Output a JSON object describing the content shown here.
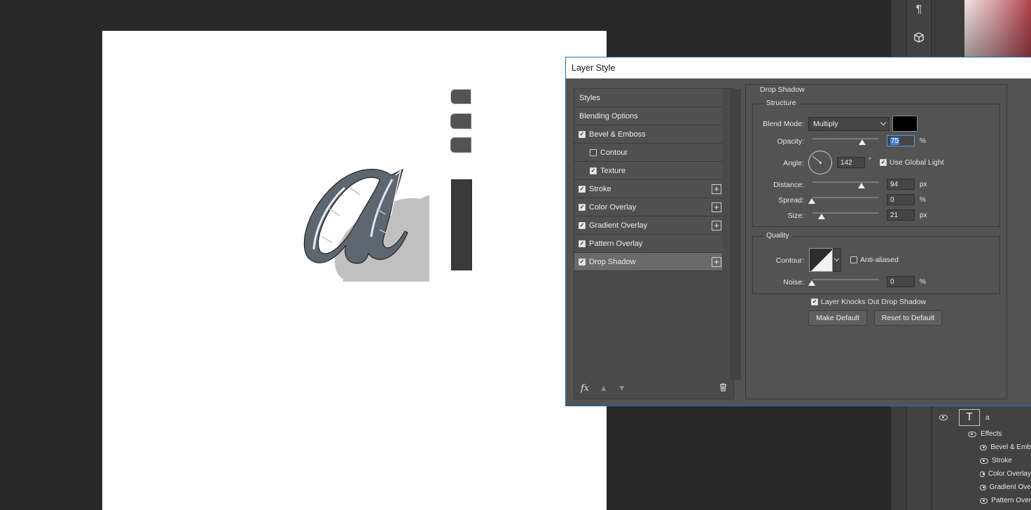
{
  "dialog": {
    "title": "Layer Style",
    "styles_list": [
      {
        "label": "Styles",
        "type": "header"
      },
      {
        "label": "Blending Options",
        "type": "header"
      },
      {
        "label": "Bevel & Emboss",
        "checked": true
      },
      {
        "label": "Contour",
        "checked": false,
        "sub": true
      },
      {
        "label": "Texture",
        "checked": true,
        "sub": true
      },
      {
        "label": "Stroke",
        "checked": true,
        "plus": true
      },
      {
        "label": "Color Overlay",
        "checked": true,
        "plus": true
      },
      {
        "label": "Gradient Overlay",
        "checked": true,
        "plus": true
      },
      {
        "label": "Pattern Overlay",
        "checked": true
      },
      {
        "label": "Drop Shadow",
        "checked": true,
        "plus": true,
        "selected": true
      }
    ],
    "footer": {
      "fx": "fx",
      "up_icon": "arrow-up-icon",
      "down_icon": "arrow-down-icon",
      "trash_icon": "trash-icon"
    },
    "drop_shadow": {
      "title": "Drop Shadow",
      "structure": {
        "title": "Structure",
        "blend_mode_label": "Blend Mode:",
        "blend_mode": "Multiply",
        "shadow_color": "#000000",
        "opacity_label": "Opacity:",
        "opacity": "75",
        "opacity_unit": "%",
        "opacity_fraction": 0.75,
        "angle_label": "Angle:",
        "angle": "142",
        "angle_unit": "°",
        "use_global_light_label": "Use Global Light",
        "use_global_light": true,
        "distance_label": "Distance:",
        "distance": "94",
        "distance_unit": "px",
        "distance_fraction": 0.75,
        "spread_label": "Spread:",
        "spread": "0",
        "spread_unit": "%",
        "size_label": "Size:",
        "size": "21",
        "size_unit": "px"
      },
      "quality": {
        "title": "Quality",
        "contour_label": "Contour:",
        "anti_aliased_label": "Anti-aliased",
        "anti_aliased": false,
        "noise_label": "Noise:",
        "noise": "0",
        "noise_unit": "%"
      },
      "layer_knocks_out_label": "Layer Knocks Out Drop Shadow",
      "layer_knocks_out": true,
      "make_default_label": "Make Default",
      "reset_default_label": "Reset to Default"
    }
  },
  "layers": {
    "text_layer_name": "a",
    "effects_label": "Effects",
    "effects": [
      "Bevel & Emb",
      "Stroke",
      "Color Overlay",
      "Gradient Ove",
      "Pattern Over"
    ]
  },
  "dock": {
    "paragraph_icon": "¶",
    "cube_icon": "3d-cube-icon"
  }
}
